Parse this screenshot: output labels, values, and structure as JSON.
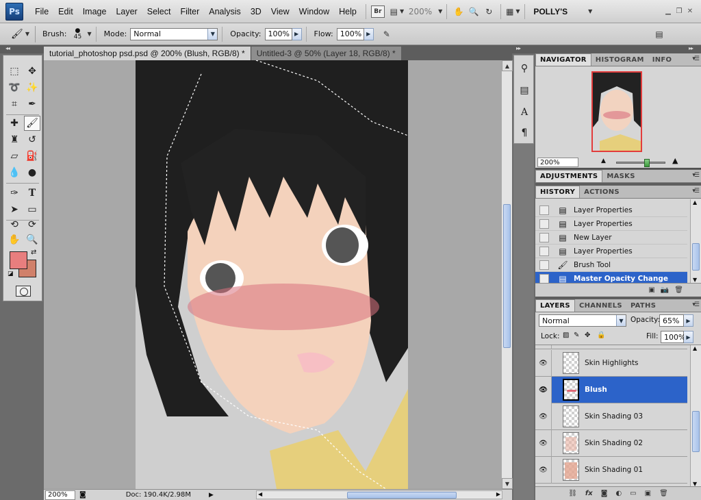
{
  "menu": {
    "logo": "Ps",
    "items": [
      "File",
      "Edit",
      "Image",
      "Layer",
      "Select",
      "Filter",
      "Analysis",
      "3D",
      "View",
      "Window",
      "Help"
    ],
    "bridge_label": "Br",
    "zoom": "200%",
    "workspace": "POLLY'S"
  },
  "options": {
    "brush_label": "Brush:",
    "brush_size": "45",
    "mode_label": "Mode:",
    "mode_value": "Normal",
    "opacity_label": "Opacity:",
    "opacity_value": "100%",
    "flow_label": "Flow:",
    "flow_value": "100%"
  },
  "documents": {
    "tabs": [
      {
        "label": "tutorial_photoshop psd.psd @ 200% (Blush, RGB/8) *",
        "active": true
      },
      {
        "label": "Untitled-3 @ 50% (Layer 18, RGB/8) *",
        "active": false
      }
    ],
    "status_zoom": "200%",
    "status_doc": "Doc: 190.4K/2.98M"
  },
  "navigator": {
    "tabs": [
      "NAVIGATOR",
      "HISTOGRAM",
      "INFO"
    ],
    "zoom": "200%"
  },
  "adjustments": {
    "tabs": [
      "ADJUSTMENTS",
      "MASKS"
    ]
  },
  "history": {
    "tabs": [
      "HISTORY",
      "ACTIONS"
    ],
    "items": [
      {
        "label": "Layer Properties",
        "icon": "document-icon"
      },
      {
        "label": "Layer Properties",
        "icon": "document-icon"
      },
      {
        "label": "New Layer",
        "icon": "document-icon"
      },
      {
        "label": "Layer Properties",
        "icon": "document-icon"
      },
      {
        "label": "Brush Tool",
        "icon": "brush-icon"
      },
      {
        "label": "Master Opacity Change",
        "icon": "document-icon",
        "selected": true
      }
    ]
  },
  "layers": {
    "tabs": [
      "LAYERS",
      "CHANNELS",
      "PATHS"
    ],
    "blend_mode": "Normal",
    "opacity_label": "Opacity:",
    "opacity_value": "65%",
    "lock_label": "Lock:",
    "fill_label": "Fill:",
    "fill_value": "100%",
    "items": [
      {
        "name": "Skin Highlights"
      },
      {
        "name": "Blush",
        "selected": true
      },
      {
        "name": "Skin Shading 03"
      },
      {
        "name": "Skin Shading 02"
      },
      {
        "name": "Skin Shading 01"
      }
    ]
  },
  "colors": {
    "foreground": "#e87e7e",
    "background": "#d0806a",
    "selection": "#2c63c9"
  }
}
